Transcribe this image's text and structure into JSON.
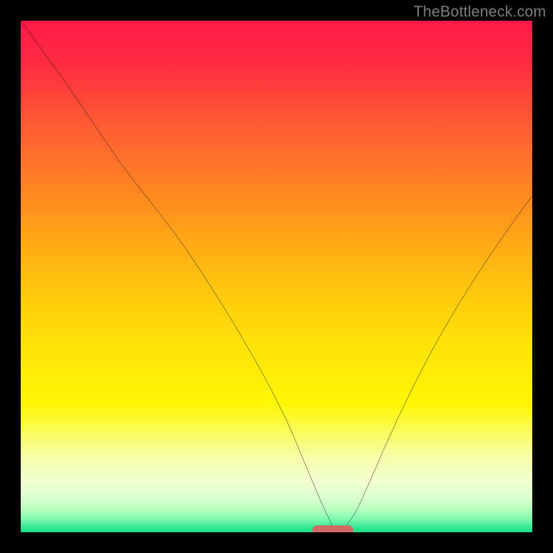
{
  "watermark": {
    "text": "TheBottleneck.com"
  },
  "gradient": {
    "stops": [
      {
        "offset": 0.0,
        "color": "#ff1a47"
      },
      {
        "offset": 0.08,
        "color": "#ff2a42"
      },
      {
        "offset": 0.2,
        "color": "#ff5a33"
      },
      {
        "offset": 0.35,
        "color": "#ff8c1f"
      },
      {
        "offset": 0.5,
        "color": "#ffbf0f"
      },
      {
        "offset": 0.63,
        "color": "#ffe208"
      },
      {
        "offset": 0.75,
        "color": "#fff705"
      },
      {
        "offset": 0.85,
        "color": "#f6ffa6"
      },
      {
        "offset": 0.9,
        "color": "#f3ffd0"
      },
      {
        "offset": 0.93,
        "color": "#dfffce"
      },
      {
        "offset": 0.955,
        "color": "#b8ffbf"
      },
      {
        "offset": 0.975,
        "color": "#7cf8ad"
      },
      {
        "offset": 0.99,
        "color": "#35e994"
      },
      {
        "offset": 1.0,
        "color": "#17df89"
      }
    ]
  },
  "chart_data": {
    "type": "line",
    "title": "",
    "xlabel": "",
    "ylabel": "",
    "xlim": [
      0,
      100
    ],
    "ylim": [
      0,
      100
    ],
    "grid": false,
    "legend": false,
    "series": [
      {
        "name": "bottleneck-curve",
        "x": [
          0,
          4,
          8,
          12,
          16,
          20,
          24,
          28,
          32,
          36,
          40,
          44,
          48,
          52,
          55,
          57.5,
          60,
          62,
          65,
          68,
          72,
          76,
          80,
          84,
          88,
          92,
          96,
          100
        ],
        "y": [
          100,
          94.5,
          89,
          83.2,
          77.3,
          71.5,
          66.3,
          61.2,
          55.8,
          49.8,
          43.5,
          36.8,
          29.7,
          21.8,
          14.8,
          8.8,
          3.2,
          0.3,
          3.2,
          9.4,
          18.5,
          27.0,
          34.8,
          41.9,
          48.4,
          54.5,
          60.3,
          65.8
        ]
      }
    ],
    "marker": {
      "x_start": 57.0,
      "x_end": 65.0,
      "y": 0.4,
      "color": "#cf6b63"
    }
  }
}
